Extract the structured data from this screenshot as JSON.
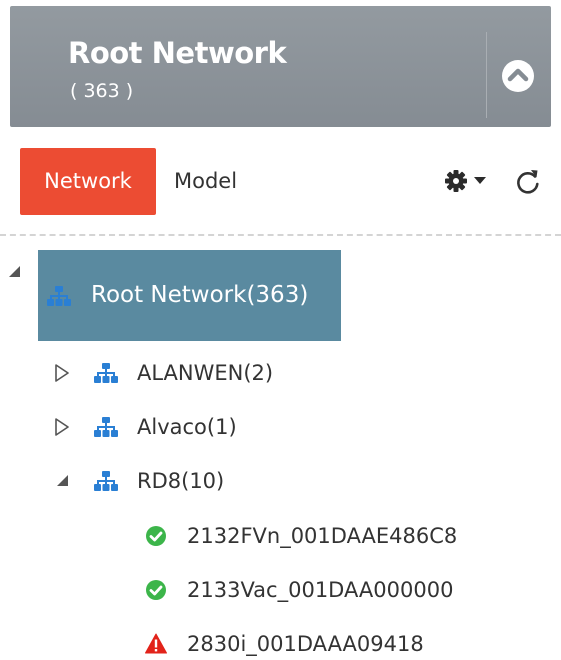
{
  "header": {
    "title": "Root Network",
    "count": "( 363 )"
  },
  "toolbar": {
    "tabs": [
      {
        "label": "Network",
        "active": true
      },
      {
        "label": "Model",
        "active": false
      }
    ],
    "icons": {
      "settings": "gear-icon",
      "dropdown": "caret-down-icon",
      "refresh": "refresh-icon"
    }
  },
  "tree": {
    "root": {
      "label": "Root Network(363)",
      "expanded": true,
      "selected": true
    },
    "children": [
      {
        "label": "ALANWEN(2)",
        "expanded": false
      },
      {
        "label": "Alvaco(1)",
        "expanded": false
      },
      {
        "label": "RD8(10)",
        "expanded": true,
        "devices": [
          {
            "label": "2132FVn_001DAAE486C8",
            "status": "ok"
          },
          {
            "label": "2133Vac_001DAA000000",
            "status": "ok"
          },
          {
            "label": "2830i_001DAAA09418",
            "status": "alert"
          }
        ]
      }
    ]
  },
  "colors": {
    "header_bg": "#8b9299",
    "active_tab": "#ec4c33",
    "selected_node": "#5a8aa0",
    "network_icon": "#2a7fd4",
    "status_ok": "#3cb54a",
    "status_alert": "#e2231a"
  }
}
